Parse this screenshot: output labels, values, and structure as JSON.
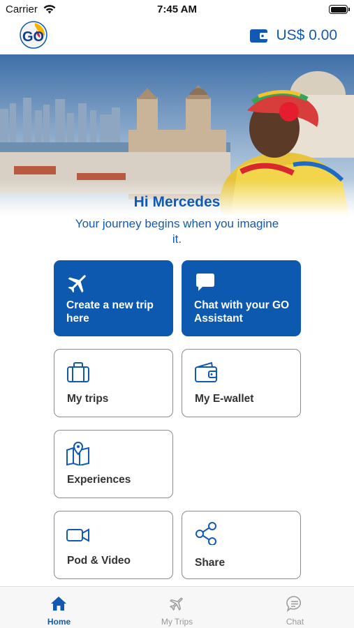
{
  "status_bar": {
    "carrier": "Carrier",
    "time": "7:45 AM"
  },
  "header": {
    "logo_text": "GO",
    "wallet_balance": "US$ 0.00"
  },
  "hero": {
    "image": "cartagena-photo",
    "greeting": "Hi Mercedes",
    "tagline": "Your journey begins when you imagine it."
  },
  "tiles": [
    {
      "label": "Create a new trip here",
      "icon": "airplane-icon",
      "style": "primary"
    },
    {
      "label": "Chat with your GO Assistant",
      "icon": "chat-bubble-icon",
      "style": "primary"
    },
    {
      "label": "My trips",
      "icon": "suitcase-icon",
      "style": "outline"
    },
    {
      "label": "My E-wallet",
      "icon": "wallet-icon",
      "style": "outline"
    },
    {
      "label": "Experiences",
      "icon": "map-pin-icon",
      "style": "outline"
    },
    {
      "label": "Pod & Video",
      "icon": "video-camera-icon",
      "style": "outline"
    },
    {
      "label": "Share",
      "icon": "share-icon",
      "style": "outline"
    }
  ],
  "tab_bar": [
    {
      "label": "Home",
      "icon": "home-icon",
      "active": true
    },
    {
      "label": "My Trips",
      "icon": "airplane-icon",
      "active": false
    },
    {
      "label": "Chat",
      "icon": "chat-icon",
      "active": false
    }
  ],
  "colors": {
    "brand_blue": "#0c59af",
    "text_blue": "#1259b3",
    "inactive_gray": "#999999"
  }
}
